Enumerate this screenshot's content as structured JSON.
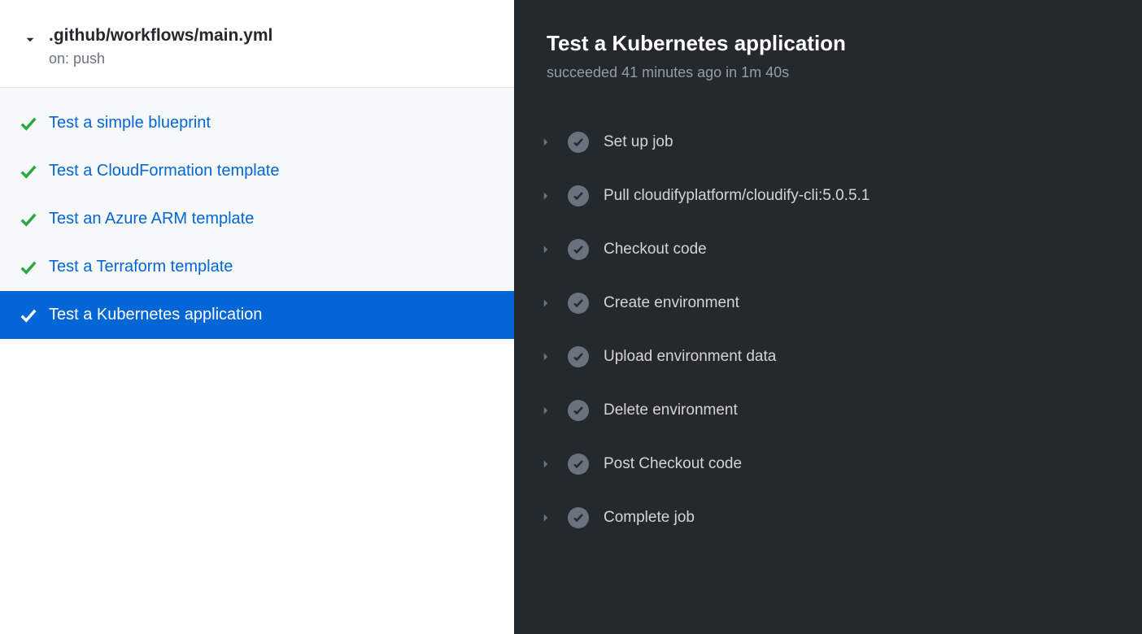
{
  "workflow": {
    "title": ".github/workflows/main.yml",
    "trigger": "on: push"
  },
  "jobs": [
    {
      "label": "Test a simple blueprint",
      "selected": false
    },
    {
      "label": "Test a CloudFormation template",
      "selected": false
    },
    {
      "label": "Test an Azure ARM template",
      "selected": false
    },
    {
      "label": "Test a Terraform template",
      "selected": false
    },
    {
      "label": "Test a Kubernetes application",
      "selected": true
    }
  ],
  "main": {
    "title": "Test a Kubernetes application",
    "status_text": "succeeded 41 minutes ago in 1m 40s"
  },
  "steps": [
    {
      "label": "Set up job"
    },
    {
      "label": "Pull cloudifyplatform/cloudify-cli:5.0.5.1"
    },
    {
      "label": "Checkout code"
    },
    {
      "label": "Create environment"
    },
    {
      "label": "Upload environment data"
    },
    {
      "label": "Delete environment"
    },
    {
      "label": "Post Checkout code"
    },
    {
      "label": "Complete job"
    }
  ],
  "colors": {
    "success_green": "#28a745",
    "link_blue": "#0366d6",
    "dark_bg": "#24292e"
  }
}
